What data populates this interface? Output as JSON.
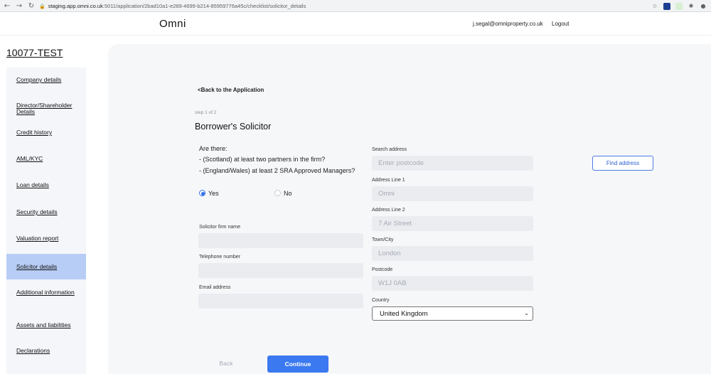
{
  "browser": {
    "url_host": "staging.app.omni.co.uk",
    "url_path": ":5011/application/2bad10a1-e289-4699-b214-85959776a45c/checklist/solicitor_details"
  },
  "header": {
    "logo": "Omni",
    "user_email": "j.segal@omniproperty.co.uk",
    "logout_label": "Logout"
  },
  "sidebar": {
    "app_id": "10077-TEST",
    "items": [
      {
        "label": "Company details"
      },
      {
        "label": "Director/Shareholder Details"
      },
      {
        "label": "Credit history"
      },
      {
        "label": "AML/KYC"
      },
      {
        "label": "Loan details"
      },
      {
        "label": "Security details"
      },
      {
        "label": "Valuation report"
      },
      {
        "label": "Solicitor details",
        "active": true
      },
      {
        "label": "Additional information"
      },
      {
        "label": "Assets and liabilities"
      },
      {
        "label": "Declarations"
      }
    ]
  },
  "main": {
    "back_link": "<Back to the Application",
    "step": "step 1 of 2",
    "title": "Borrower's Solicitor",
    "question": {
      "line1": "Are there:",
      "line2": "- (Scotland) at least two partners in the firm?",
      "line3": "- (England/Wales) at least 2 SRA Approved Managers?"
    },
    "radio_yes": "Yes",
    "radio_no": "No",
    "selected_option": "Yes",
    "solicitor_firm_label": "Solicitor firm name",
    "solicitor_firm_value": "",
    "telephone_label": "Telephone number",
    "telephone_value": "",
    "email_label": "Email address",
    "email_value": "",
    "search_address_label": "Search address",
    "search_address_placeholder": "Enter postcode",
    "find_address_label": "Find address",
    "address_line1_label": "Address Line 1",
    "address_line1_value": "Omni",
    "address_line2_label": "Address Line 2",
    "address_line2_value": "7 Air Street",
    "town_label": "Town/City",
    "town_value": "London",
    "postcode_label": "Postcode",
    "postcode_value": "W1J 0AB",
    "country_label": "Country",
    "country_value": "United Kingdom",
    "back_button": "Back",
    "continue_button": "Continue"
  }
}
